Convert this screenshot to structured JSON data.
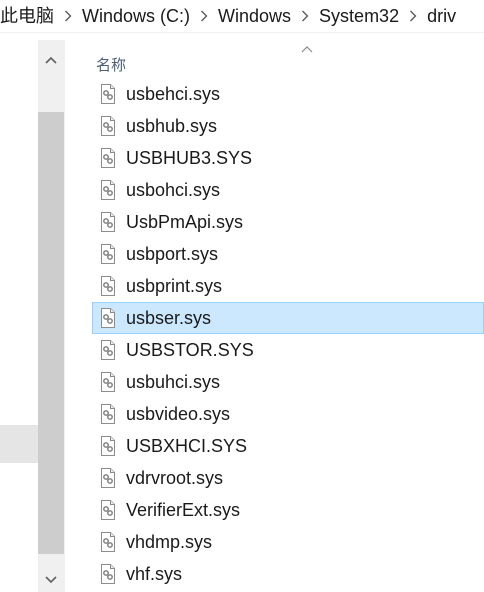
{
  "breadcrumb": {
    "items": [
      "此电脑",
      "Windows (C:)",
      "Windows",
      "System32",
      "driv"
    ]
  },
  "columns": {
    "name_header": "名称"
  },
  "files": [
    {
      "name": "usbehci.sys",
      "selected": false
    },
    {
      "name": "usbhub.sys",
      "selected": false
    },
    {
      "name": "USBHUB3.SYS",
      "selected": false
    },
    {
      "name": "usbohci.sys",
      "selected": false
    },
    {
      "name": "UsbPmApi.sys",
      "selected": false
    },
    {
      "name": "usbport.sys",
      "selected": false
    },
    {
      "name": "usbprint.sys",
      "selected": false
    },
    {
      "name": "usbser.sys",
      "selected": true
    },
    {
      "name": "USBSTOR.SYS",
      "selected": false
    },
    {
      "name": "usbuhci.sys",
      "selected": false
    },
    {
      "name": "usbvideo.sys",
      "selected": false
    },
    {
      "name": "USBXHCI.SYS",
      "selected": false
    },
    {
      "name": "vdrvroot.sys",
      "selected": false
    },
    {
      "name": "VerifierExt.sys",
      "selected": false
    },
    {
      "name": "vhdmp.sys",
      "selected": false
    },
    {
      "name": "vhf.sys",
      "selected": false
    }
  ],
  "icons": {
    "file": "system-file-icon",
    "separator": "chevron-right-icon",
    "scroll_up": "scroll-up-arrow-icon",
    "scroll_down": "scroll-down-arrow-icon",
    "sort": "sort-ascending-icon"
  },
  "colors": {
    "selection_bg": "#cce8ff",
    "selection_border": "#99d1ff",
    "header_text": "#4c607a",
    "scrollbar_track": "#f0f0f0",
    "scrollbar_thumb": "#cdcdcd"
  }
}
